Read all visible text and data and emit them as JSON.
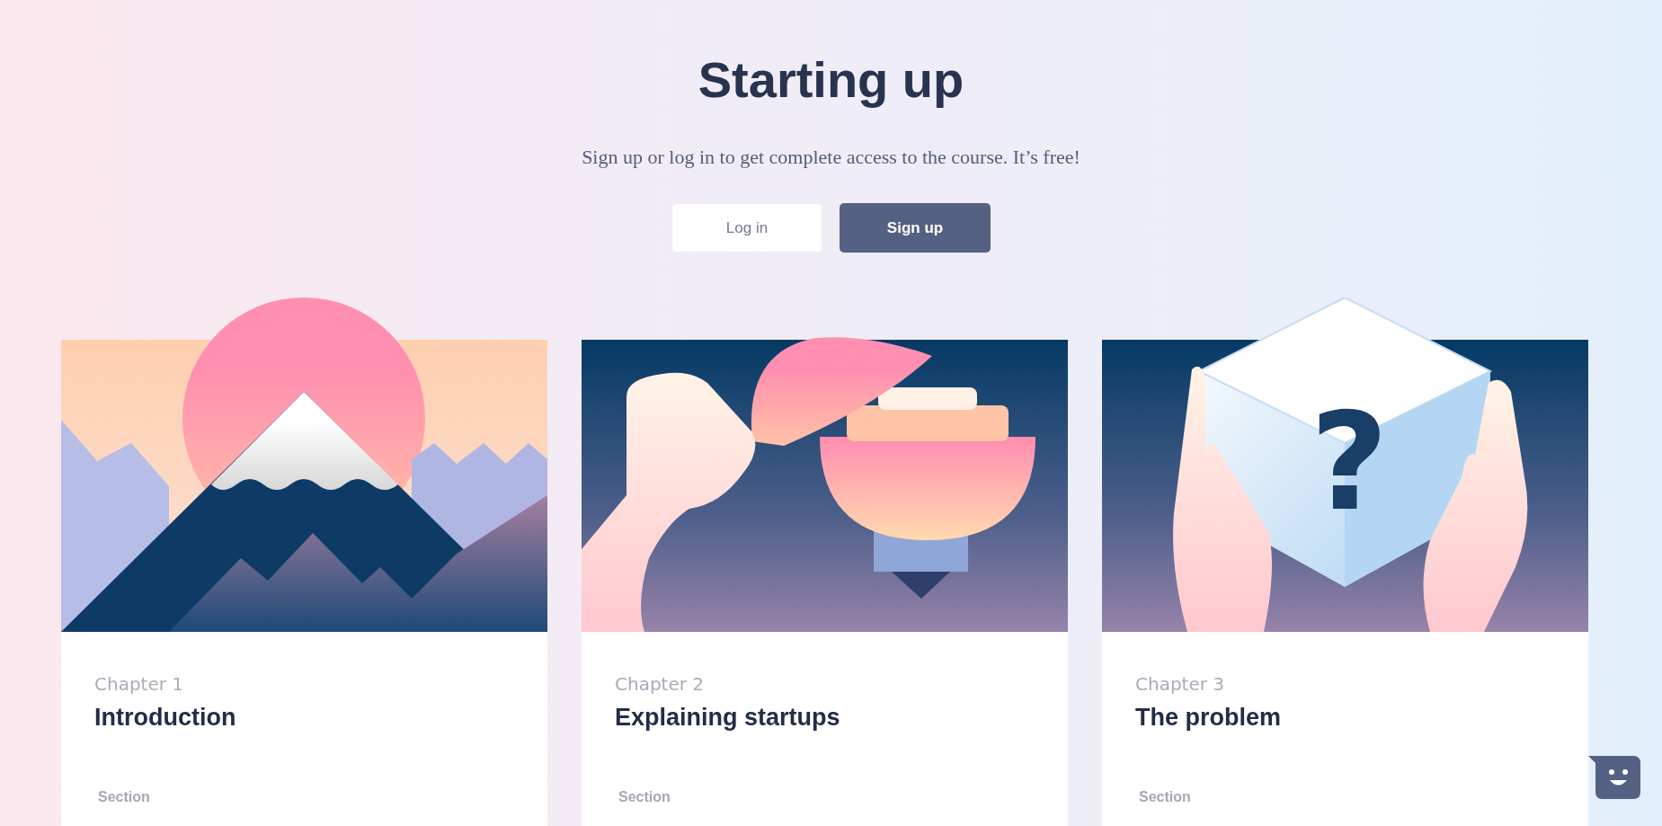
{
  "header": {
    "title": "Starting up",
    "subtitle": "Sign up or log in to get complete access to the course. It’s free!"
  },
  "buttons": [
    {
      "label": "Log in",
      "kind": "secondary"
    },
    {
      "label": "Sign up",
      "kind": "primary"
    }
  ],
  "chapters": [
    {
      "chapter": "Chapter 1",
      "title": "Introduction",
      "section": "Section",
      "kind": "mountain"
    },
    {
      "chapter": "Chapter 2",
      "title": "Explaining startups",
      "section": "Section",
      "kind": "lamp"
    },
    {
      "chapter": "Chapter 3",
      "title": "The problem",
      "section": "Section",
      "kind": "cube",
      "mark": "?"
    }
  ]
}
